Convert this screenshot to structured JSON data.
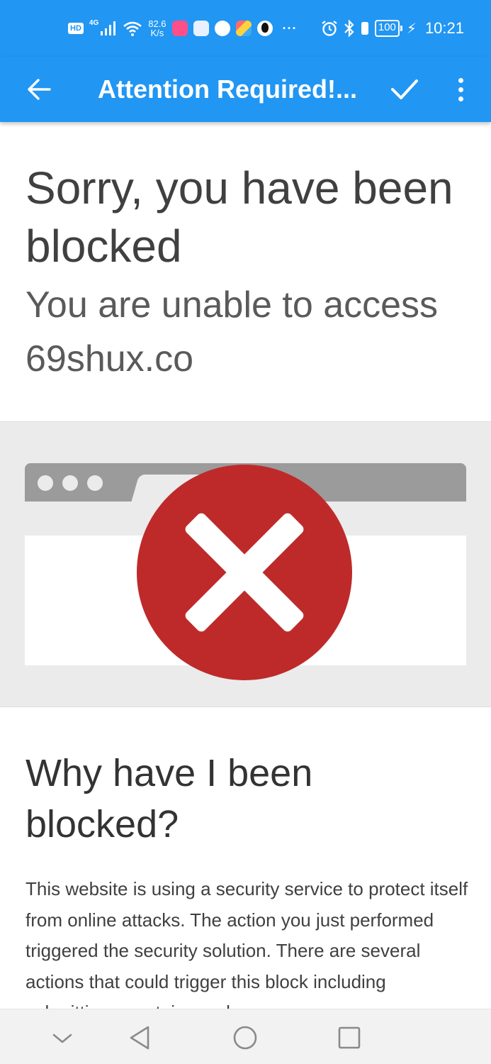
{
  "status_bar": {
    "hd_badge": "HD",
    "network": "4G",
    "speed_value": "82.6",
    "speed_unit": "K/s",
    "more": "···",
    "battery": "100",
    "time": "10:21",
    "icons": [
      "signal-icon",
      "wifi-icon",
      "app-icon",
      "mail-icon",
      "browser-icon",
      "app-icon",
      "qq-icon",
      "alarm-icon",
      "bluetooth-icon",
      "battery-icon",
      "charging-icon"
    ]
  },
  "app_bar": {
    "title": "Attention Required!...",
    "back_icon": "arrow-back-icon",
    "confirm_icon": "check-icon",
    "menu_icon": "more-vert-icon",
    "color": "#2196F3"
  },
  "page": {
    "headline": "Sorry, you have been blocked",
    "subheadline": "You are unable to access 69shux.co",
    "why_heading": "Why have I been blocked?",
    "why_body": "This website is using a security service to protect itself from online attacks. The action you just performed triggered the security solution. There are several actions that could trigger this block including submitting a certain word or"
  },
  "illustration": {
    "icon": "blocked-x-icon",
    "circle_color": "#be2a2a"
  },
  "nav_bar": {
    "icons": [
      "chevron-down-icon",
      "back-triangle-icon",
      "home-circle-icon",
      "recents-square-icon"
    ]
  }
}
